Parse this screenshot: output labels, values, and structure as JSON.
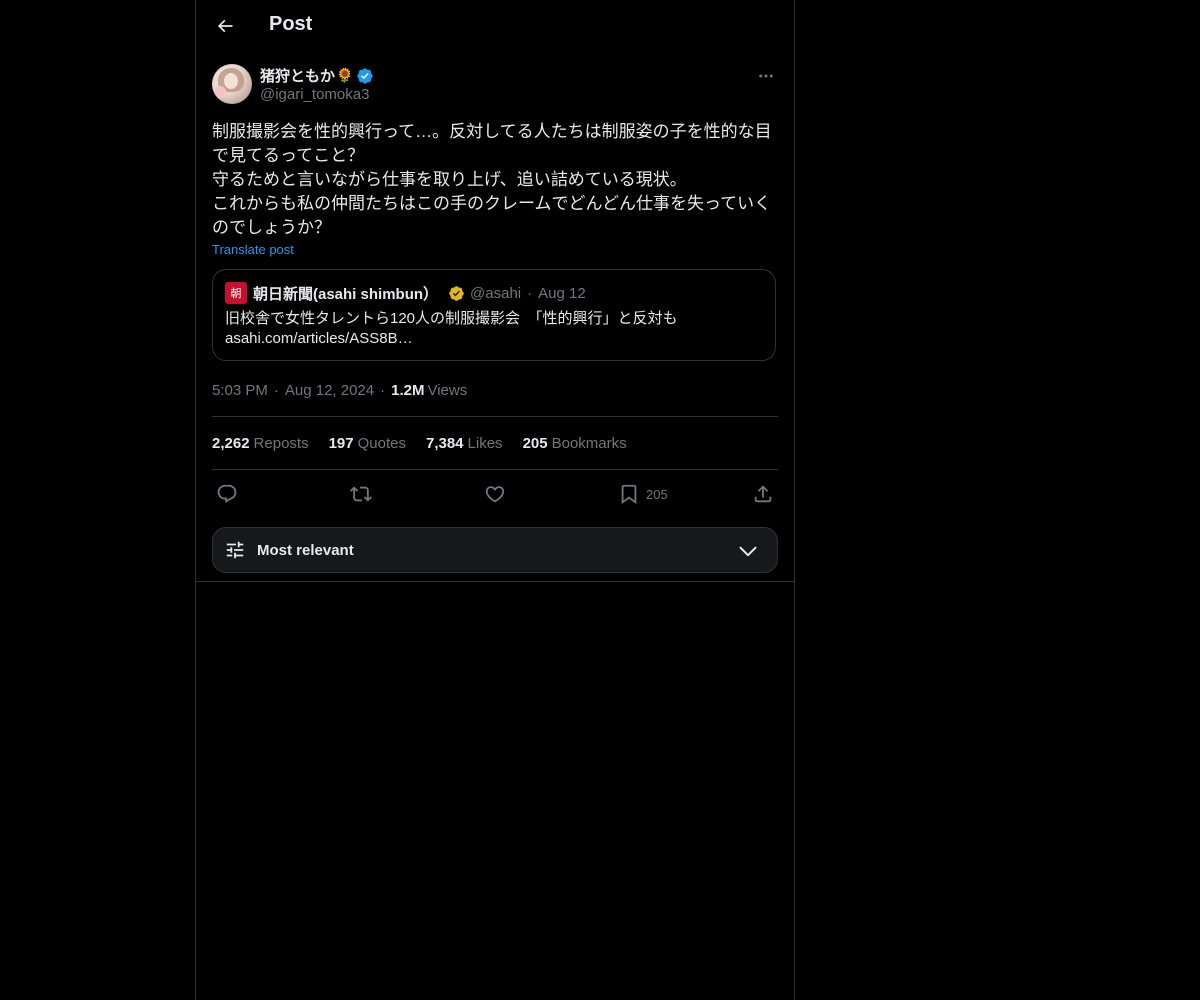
{
  "header": {
    "title": "Post",
    "back_icon": "arrow-left-icon"
  },
  "post": {
    "author": {
      "name": "猪狩ともか",
      "emoji": "🌻",
      "handle": "@igari_tomoka3",
      "verified_badge": "blue-verified-icon",
      "verified_color": "#1d9bf0"
    },
    "more_icon": "more-horizontal-icon",
    "text": "制服撮影会を性的興行って…。反対してる人たちは制服姿の子を性的な目で見てるってこと？\n守るためと言いながら仕事を取り上げ、追い詰めている現状。\nこれからも私の仲間たちはこの手のクレームでどんどん仕事を失っていくのでしょうか？",
    "translate_label": "Translate post",
    "quote": {
      "logo_text": "朝",
      "name": "朝日新聞(asahi shimbun）",
      "badge": "gold-verified-icon",
      "badge_color": "#e2b719",
      "handle": "@asahi",
      "separator": "·",
      "date": "Aug 12",
      "text": "旧校舎で女性タレントら120人の制服撮影会　「性的興行」と反対も\nasahi.com/articles/ASS8B…"
    },
    "meta": {
      "time": "5:03 PM",
      "separator": "·",
      "date": "Aug 12, 2024",
      "views_count": "1.2M",
      "views_label": "Views"
    },
    "stats": [
      {
        "count": "2,262",
        "label": "Reposts"
      },
      {
        "count": "197",
        "label": "Quotes"
      },
      {
        "count": "7,384",
        "label": "Likes"
      },
      {
        "count": "205",
        "label": "Bookmarks"
      }
    ],
    "actions": {
      "reply_icon": "reply-icon",
      "repost_icon": "repost-icon",
      "like_icon": "heart-icon",
      "bookmark_icon": "bookmark-icon",
      "bookmark_count": "205",
      "share_icon": "share-icon"
    }
  },
  "sort": {
    "label": "Most relevant",
    "icon": "sliders-icon",
    "chevron": "chevron-down-icon"
  }
}
